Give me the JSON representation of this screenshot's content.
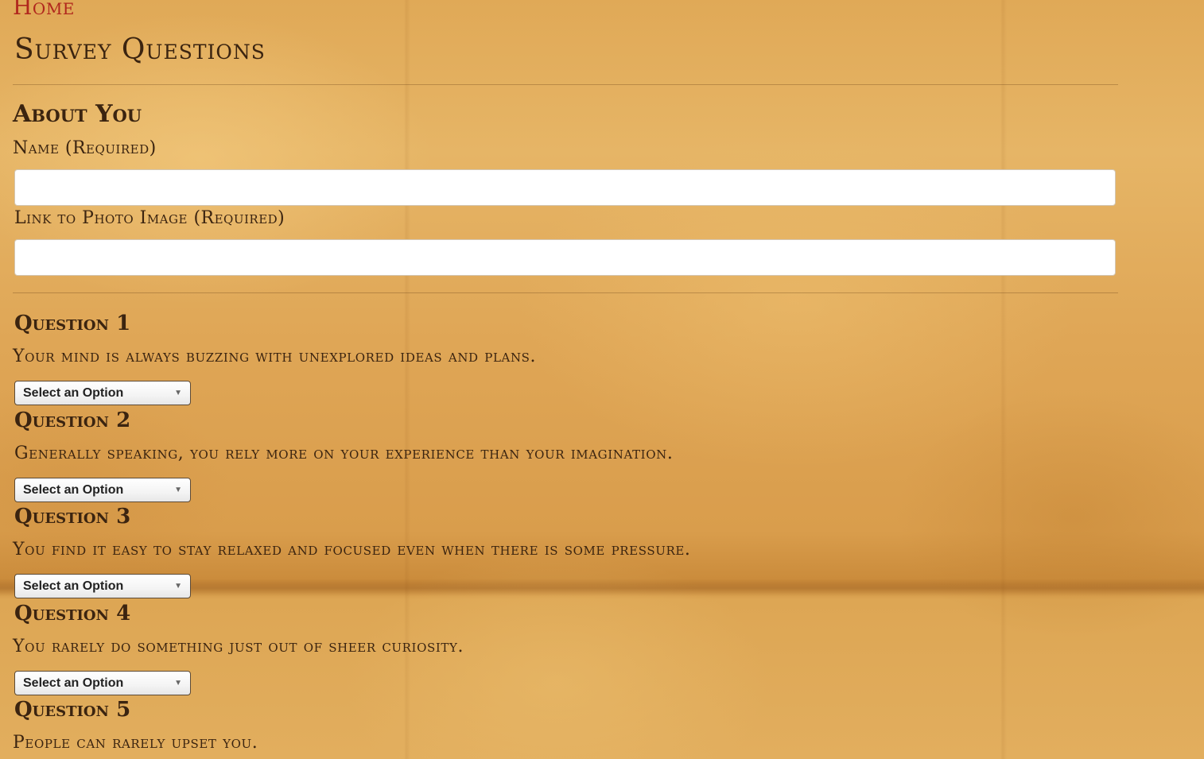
{
  "nav": {
    "home_label": "Home"
  },
  "page": {
    "title": "Survey Questions"
  },
  "about": {
    "section_title": "About You",
    "name_label": "Name (Required)",
    "name_value": "",
    "photo_label": "Link to Photo Image (Required)",
    "photo_value": ""
  },
  "questions": [
    {
      "title": "Question 1",
      "text": "Your mind is always buzzing with unexplored ideas and plans.",
      "selected": "Select an Option"
    },
    {
      "title": "Question 2",
      "text": "Generally speaking, you rely more on your experience than your imagination.",
      "selected": "Select an Option"
    },
    {
      "title": "Question 3",
      "text": "You find it easy to stay relaxed and focused even when there is some pressure.",
      "selected": "Select an Option"
    },
    {
      "title": "Question 4",
      "text": "You rarely do something just out of sheer curiosity.",
      "selected": "Select an Option"
    },
    {
      "title": "Question 5",
      "text": "People can rarely upset you."
    }
  ],
  "colors": {
    "link": "#b0271d",
    "text": "#3b2410",
    "parchment": "#e2ad5c"
  },
  "icons": {
    "select_arrow": "triangle-down-icon"
  }
}
